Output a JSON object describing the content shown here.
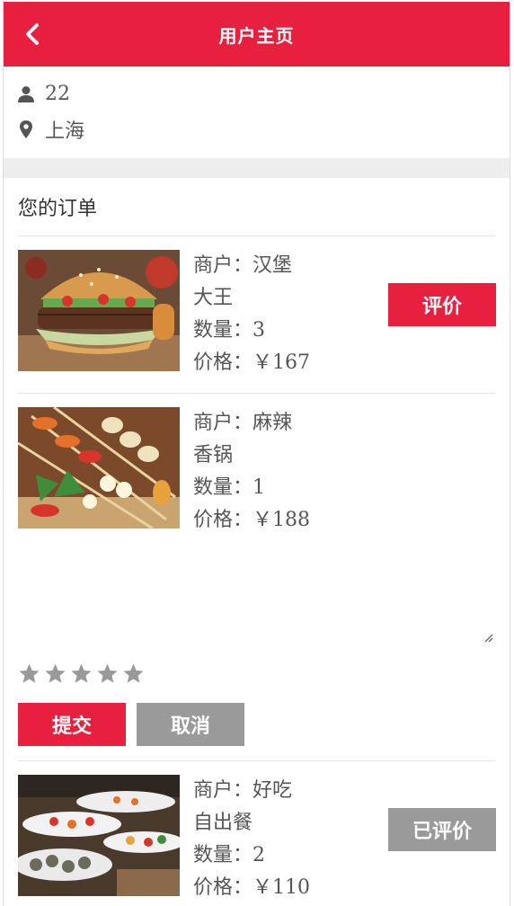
{
  "header": {
    "title": "用户主页",
    "back_icon": "chevron-left-icon"
  },
  "user": {
    "id_icon": "user-icon",
    "id": "22",
    "location_icon": "map-pin-icon",
    "location": "上海"
  },
  "orders_section": {
    "title": "您的订单"
  },
  "labels": {
    "merchant": "商户：",
    "quantity": "数量：",
    "price": "价格："
  },
  "orders": [
    {
      "merchant_line1": "汉堡",
      "merchant_line2": "大王",
      "quantity": "3",
      "price": "￥167",
      "action": "评价",
      "image": "burger-photo"
    },
    {
      "merchant_line1": "麻辣",
      "merchant_line2": "香锅",
      "quantity": "1",
      "price": "￥188",
      "image": "skewers-photo"
    },
    {
      "merchant_line1": "好吃",
      "merchant_line2": "自出餐",
      "quantity": "2",
      "price": "￥110",
      "action": "已评价",
      "image": "buffet-photo"
    }
  ],
  "review": {
    "rating": 0,
    "max_rating": 5,
    "submit": "提交",
    "cancel": "取消",
    "comment": ""
  },
  "colors": {
    "accent": "#e8203f",
    "muted_button": "#9a9a9a",
    "star": "#999999"
  }
}
